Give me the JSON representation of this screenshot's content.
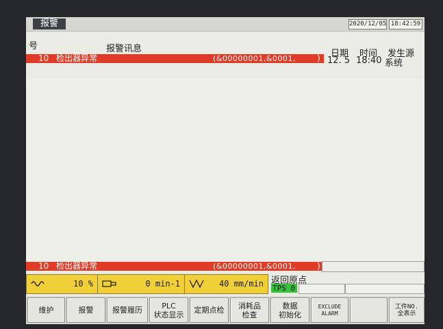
{
  "window": {
    "tab_title": "报警",
    "date": "2020/12/05",
    "time": "18:42:59"
  },
  "header": {
    "num_col": "号",
    "message_col": "报警讯息",
    "date_col": "日期",
    "time_col": "时间",
    "source_col": "发生源"
  },
  "alarm": {
    "number": "10",
    "message": "检出器异常",
    "code": "(&00000001,&0001,",
    "close_paren": ")",
    "date": "12. 5",
    "time": "18:40",
    "source": "系统"
  },
  "status": {
    "spindle_override": "10 %",
    "spindle_speed": "0 min-1",
    "feed_rate": "40 mm/min",
    "return_origin": "返回原点",
    "tps": "TPS 0"
  },
  "softkeys": [
    {
      "label": "维护"
    },
    {
      "label": "报警"
    },
    {
      "label": "报警履历"
    },
    {
      "label": "PLC\n状态显示"
    },
    {
      "label": "定期点检"
    },
    {
      "label": "消耗品\n检查"
    },
    {
      "label": "数据\n初始化"
    },
    {
      "label": "EXCLUDE\nALARM"
    },
    {
      "label": ""
    },
    {
      "label": "工件NO.\n全表示"
    }
  ],
  "colors": {
    "alarm_red": "#e03b26",
    "status_yellow": "#f1cf39",
    "tps_green": "#35c23a"
  }
}
